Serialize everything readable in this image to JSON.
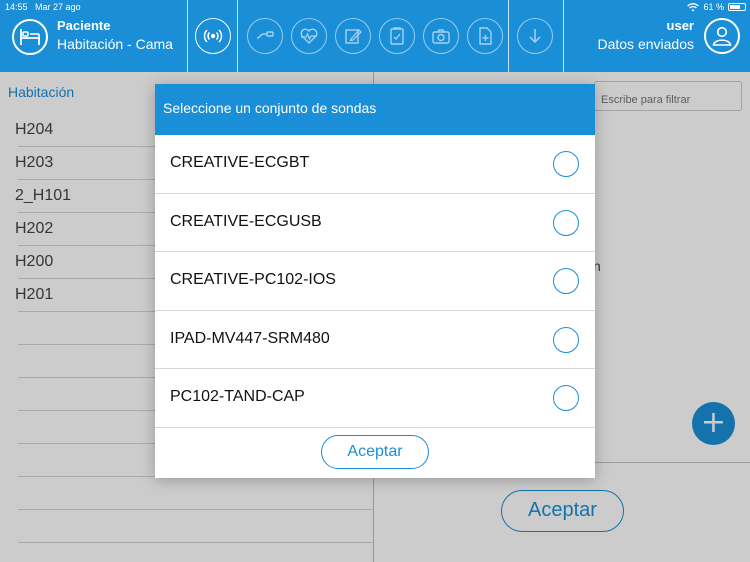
{
  "status_bar": {
    "time": "14:55",
    "date": "Mar 27 ago",
    "battery": "61 %",
    "battery_level": 0.61
  },
  "header": {
    "patient_label": "Paciente",
    "room_bed_label": "Habitación - Cama",
    "user_label": "user",
    "data_status": "Datos enviados",
    "toolbar_icons": [
      "broadcast-icon",
      "probe-icon",
      "heart-monitor-icon",
      "edit-icon",
      "clipboard-icon",
      "camera-icon",
      "document-icon",
      "download-icon"
    ]
  },
  "left_pane": {
    "heading": "Habitación",
    "rooms": [
      "H204",
      "H203",
      "2_H101",
      "H202",
      "H200",
      "H201"
    ]
  },
  "right_pane": {
    "filter_placeholder": "Escribe para filtrar",
    "partial_text": "n",
    "add_symbol": "+",
    "accept_label": "Aceptar"
  },
  "modal": {
    "title": "Seleccione un conjunto de sondas",
    "options": [
      "CREATIVE-ECGBT",
      "CREATIVE-ECGUSB",
      "CREATIVE-PC102-IOS",
      "IPAD-MV447-SRM480",
      "PC102-TAND-CAP"
    ],
    "accept_label": "Aceptar"
  },
  "colors": {
    "accent": "#1a8fd8",
    "divider": "#d9d9d9"
  }
}
